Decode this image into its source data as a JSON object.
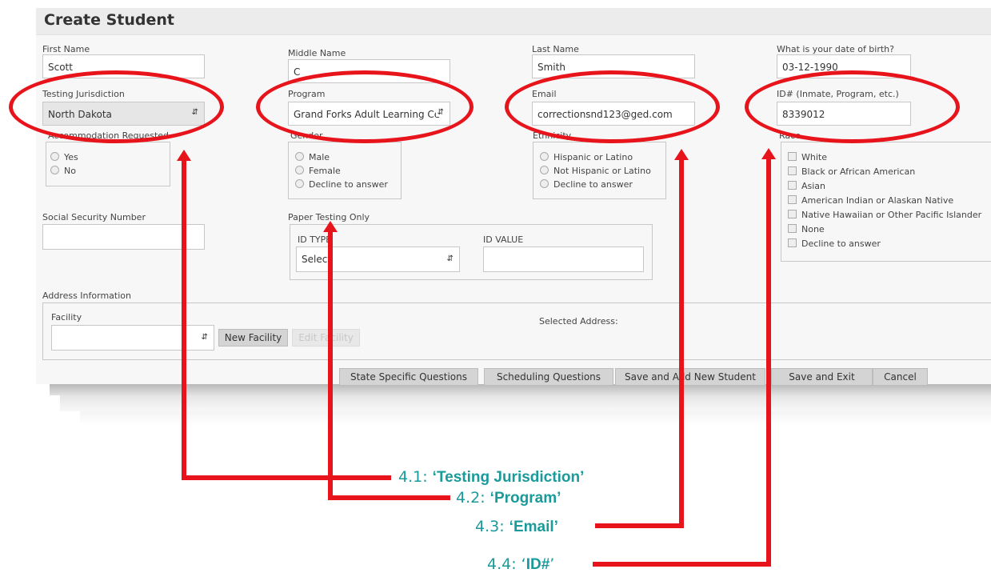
{
  "form": {
    "title": "Create Student",
    "first_name": {
      "label": "First Name",
      "value": "Scott"
    },
    "middle_name": {
      "label": "Middle Name",
      "value": "C"
    },
    "last_name": {
      "label": "Last Name",
      "value": "Smith"
    },
    "dob": {
      "label": "What is your date of birth?",
      "value": "03-12-1990"
    },
    "jurisdiction": {
      "label": "Testing Jurisdiction",
      "value": "North Dakota"
    },
    "program": {
      "label": "Program",
      "value": "Grand Forks Adult Learning Ce"
    },
    "email": {
      "label": "Email",
      "value": "correctionsnd123@ged.com"
    },
    "id_number": {
      "label": "ID# (Inmate, Program, etc.)",
      "value": "8339012"
    },
    "accommodation": {
      "label": "Accommodation Requested",
      "options": [
        "Yes",
        "No"
      ]
    },
    "gender": {
      "label": "Gender",
      "options": [
        "Male",
        "Female",
        "Decline to answer"
      ]
    },
    "ethnicity": {
      "label": "Ethnicity",
      "options": [
        "Hispanic or Latino",
        "Not Hispanic or Latino",
        "Decline to answer"
      ]
    },
    "race": {
      "label": "Race",
      "options": [
        "White",
        "Black or African American",
        "Asian",
        "American Indian or Alaskan Native",
        "Native Hawaiian or Other Pacific Islander",
        "None",
        "Decline to answer"
      ]
    },
    "ssn": {
      "label": "Social Security Number",
      "value": ""
    },
    "paper_testing": {
      "label": "Paper Testing Only",
      "id_type_label": "ID TYPE",
      "id_type_value": "Select",
      "id_value_label": "ID VALUE"
    },
    "address": {
      "label": "Address Information",
      "facility_label": "Facility",
      "new_facility": "New Facility",
      "edit_facility": "Edit Facility",
      "selected_address": "Selected Address:"
    },
    "buttons": {
      "state_specific": "State Specific Questions",
      "scheduling": "Scheduling Questions",
      "save_add": "Save and Add New Student",
      "save_exit": "Save and Exit",
      "cancel": "Cancel"
    }
  },
  "annotations": [
    {
      "prefix": "4.1: ",
      "text": "‘Testing Jurisdiction’"
    },
    {
      "prefix": "4.2: ",
      "text": "‘Program’"
    },
    {
      "prefix": "4.3: ",
      "text": "‘Email’"
    },
    {
      "prefix": "4.4: ‘",
      "text": "ID#",
      "suffix": "’"
    }
  ],
  "colors": {
    "highlight": "#e8141b",
    "annotation_text": "#1a9a9a"
  }
}
